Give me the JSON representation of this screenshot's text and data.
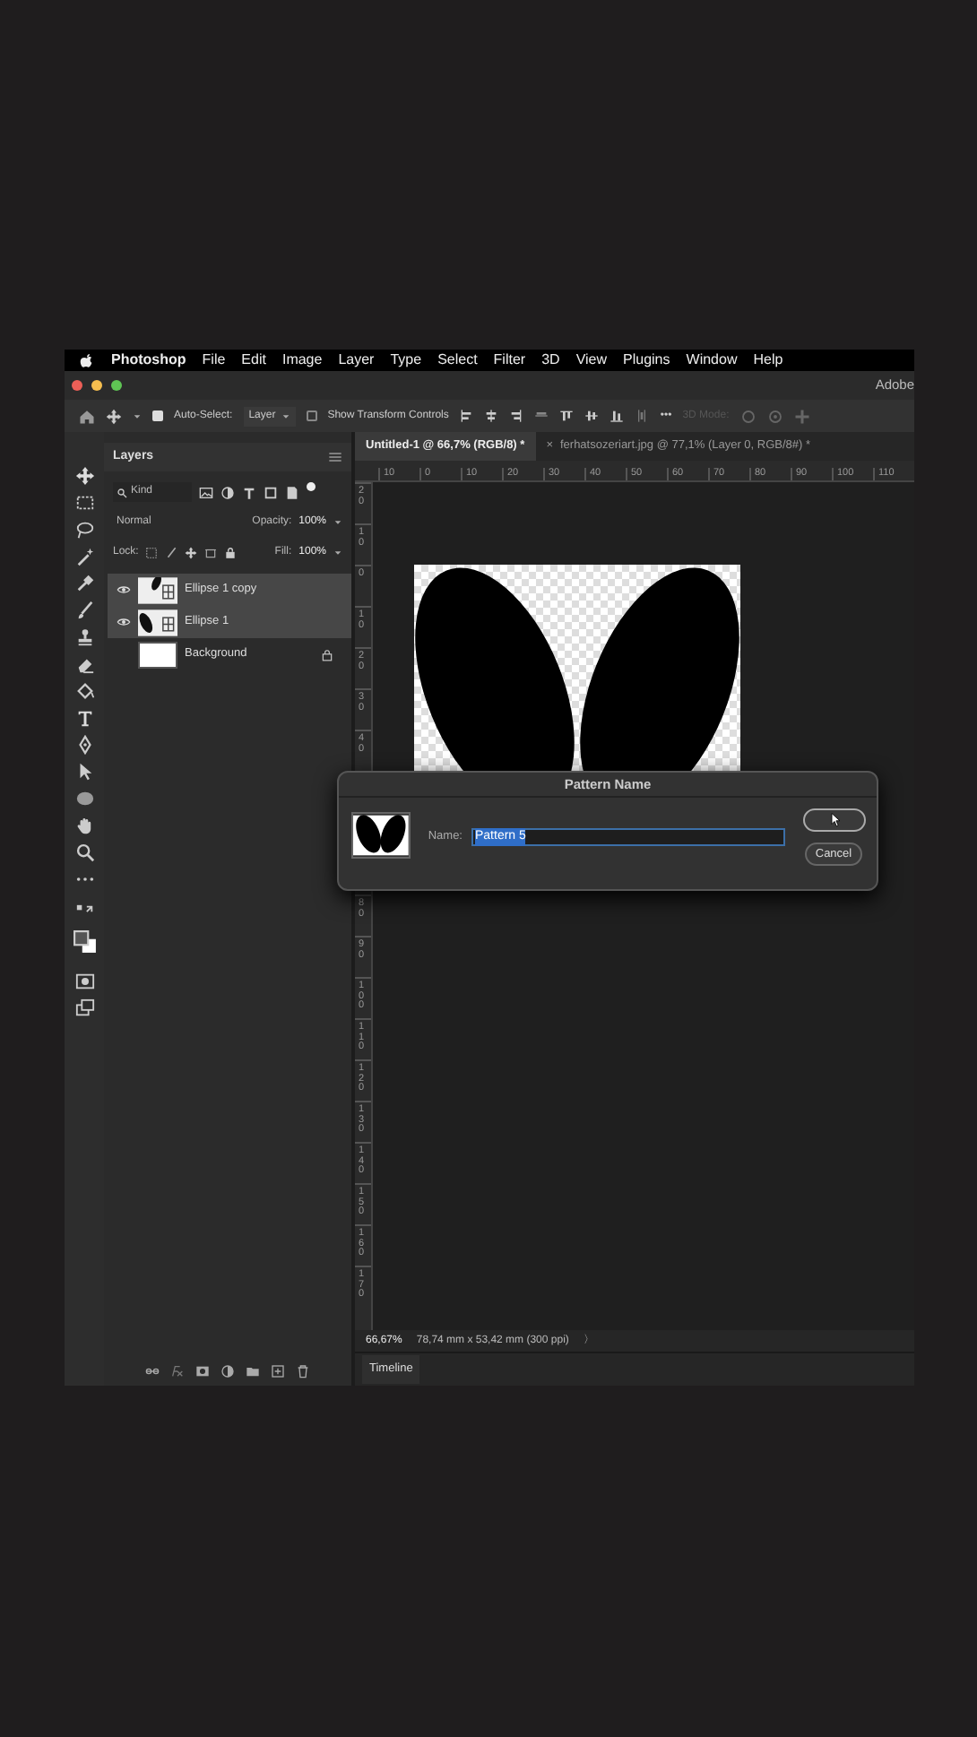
{
  "menu_bar": {
    "app": "Photoshop",
    "items": [
      "File",
      "Edit",
      "Image",
      "Layer",
      "Type",
      "Select",
      "Filter",
      "3D",
      "View",
      "Plugins",
      "Window",
      "Help"
    ]
  },
  "title_bar": {
    "text": "Adobe"
  },
  "options_bar": {
    "auto_select": {
      "label": "Auto-Select:",
      "checked": true
    },
    "target": "Layer",
    "transform_controls": {
      "label": "Show Transform Controls",
      "checked": false
    },
    "more": "•••",
    "mode_3d": {
      "label": "3D Mode:",
      "disabled": true
    }
  },
  "layers_panel": {
    "title": "Layers",
    "filter": "Kind",
    "blend_mode": "Normal",
    "opacity_label": "Opacity:",
    "opacity": "100%",
    "lock_label": "Lock:",
    "fill_label": "Fill:",
    "fill": "100%",
    "layers": [
      {
        "name": "Ellipse 1 copy",
        "kind": "shape",
        "visible": true,
        "selected": true,
        "locked": false
      },
      {
        "name": "Ellipse 1",
        "kind": "shape",
        "visible": true,
        "selected": true,
        "locked": false
      },
      {
        "name": "Background",
        "kind": "background",
        "visible": false,
        "selected": false,
        "locked": true
      }
    ]
  },
  "tabs": [
    {
      "label": "Untitled-1 @ 66,7% (RGB/8) *",
      "selected": true
    },
    {
      "label": "ferhatsozeriart.jpg @ 77,1% (Layer 0, RGB/8#) *",
      "selected": false,
      "close": "×"
    }
  ],
  "horizontal_ruler": [
    "10",
    "0",
    "10",
    "20",
    "30",
    "40",
    "50",
    "60",
    "70",
    "80",
    "90",
    "100",
    "110"
  ],
  "vertical_ruler": {
    "upper": [
      "20",
      "10",
      "0",
      "10",
      "20",
      "30",
      "40"
    ],
    "lower": [
      "80",
      "90",
      "100",
      "110",
      "120",
      "130",
      "140",
      "150",
      "160",
      "170"
    ]
  },
  "dialog": {
    "title": "Pattern Name",
    "name_label": "Name:",
    "name_value": "Pattern 5",
    "cancel": "Cancel"
  },
  "status_bar": {
    "zoom": "66,67%",
    "size": "78,74 mm x 53,42 mm (300 ppi)",
    "arrow": "〉"
  },
  "timeline": {
    "label": "Timeline"
  }
}
